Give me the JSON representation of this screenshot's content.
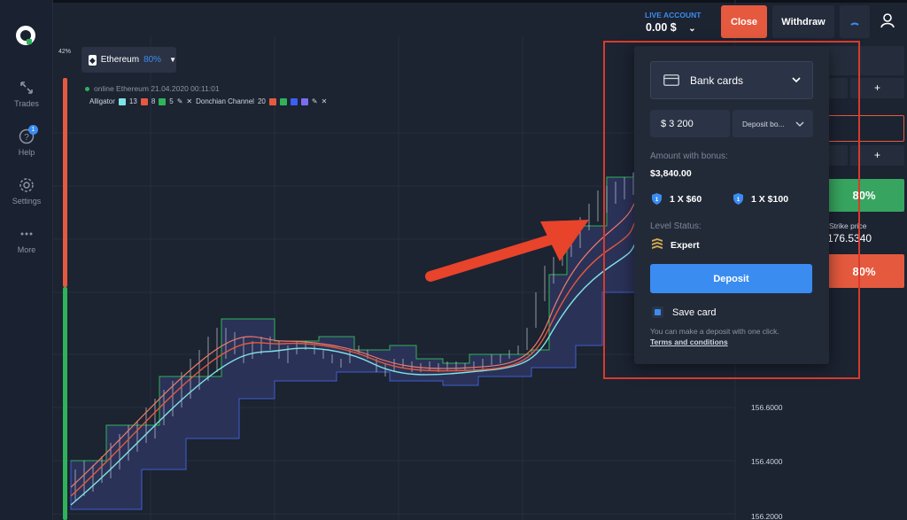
{
  "sidebar": {
    "items": [
      {
        "label": "Trades"
      },
      {
        "label": "Help",
        "badge": "1"
      },
      {
        "label": "Settings"
      },
      {
        "label": "More"
      }
    ]
  },
  "header": {
    "account_type": "LIVE ACCOUNT",
    "balance": "0.00 $",
    "close_label": "Close",
    "withdraw_label": "Withdraw"
  },
  "chart": {
    "percent_top": "42%",
    "asset_name": "Ethereum",
    "asset_payout": "80%",
    "status_line": "online Ethereum  21.04.2020 00:11:01",
    "indicator_alligator": "Alligator",
    "alligator_values": [
      "13",
      "8",
      "5"
    ],
    "indicator_donchian": "Donchian Channel",
    "donchian_value": "20",
    "price_labels": [
      "156.6000",
      "156.4000",
      "156.2000"
    ],
    "colors": {
      "up": "#2fb35a",
      "down": "#e55a3f",
      "accent": "#3b8cf0"
    }
  },
  "right_panel": {
    "strike_label": "Strike price",
    "strike_value": "176.5340",
    "up_payout": "80%",
    "down_payout": "80%",
    "plus": "+"
  },
  "deposit_popup": {
    "payment_method": "Bank cards",
    "amount": "$ 3 200",
    "bonus_select": "Deposit bo...",
    "amount_with_bonus_label": "Amount with bonus:",
    "amount_with_bonus_value": "$3,840.00",
    "promo1": "1 X $60",
    "promo2": "1 X $100",
    "level_label": "Level Status:",
    "level_value": "Expert",
    "deposit_button": "Deposit",
    "save_card_label": "Save card",
    "note": "You can make a deposit with one click.",
    "terms": "Terms and conditions"
  }
}
